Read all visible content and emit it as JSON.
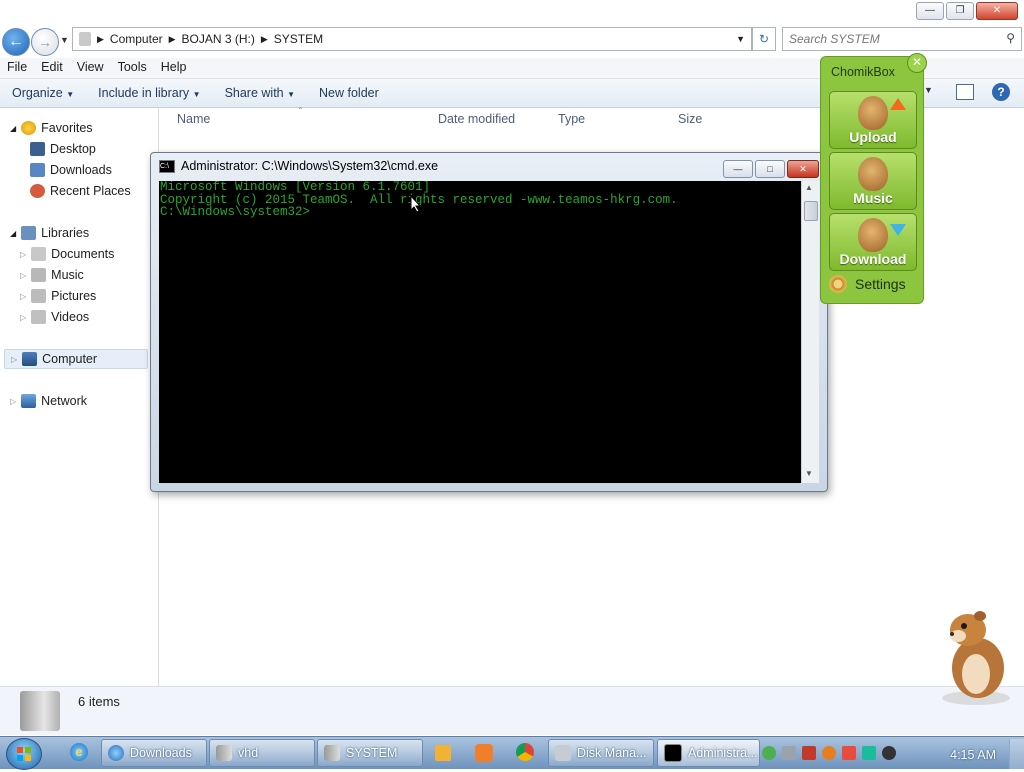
{
  "explorer": {
    "breadcrumb": [
      "Computer",
      "BOJAN 3 (H:)",
      "SYSTEM"
    ],
    "search_placeholder": "Search SYSTEM",
    "menu": [
      "File",
      "Edit",
      "View",
      "Tools",
      "Help"
    ],
    "commands": [
      "Organize",
      "Include in library",
      "Share with",
      "New folder"
    ],
    "nav": {
      "favorites": "Favorites",
      "favorites_items": [
        "Desktop",
        "Downloads",
        "Recent Places"
      ],
      "libraries": "Libraries",
      "libraries_items": [
        "Documents",
        "Music",
        "Pictures",
        "Videos"
      ],
      "computer": "Computer",
      "network": "Network"
    },
    "columns": [
      "Name",
      "Date modified",
      "Type",
      "Size"
    ],
    "status": "6 items"
  },
  "cmd": {
    "title": "Administrator: C:\\Windows\\System32\\cmd.exe",
    "lines": [
      "Microsoft Windows [Version 6.1.7601]",
      "Copyright (c) 2015 TeamOS.  All rights reserved -www.teamos-hkrg.com.",
      "",
      "C:\\Windows\\system32>"
    ]
  },
  "chomikbox": {
    "title": "ChomikBox",
    "upload": "Upload",
    "music": "Music",
    "download": "Download",
    "settings": "Settings"
  },
  "taskbar": {
    "items": [
      "Downloads",
      "vhd",
      "SYSTEM",
      "Disk Mana...",
      "Administra..."
    ],
    "clock": "4:15 AM"
  },
  "colors": {
    "console_text": "#27a82c",
    "chomik_green": "#8cc63f"
  }
}
